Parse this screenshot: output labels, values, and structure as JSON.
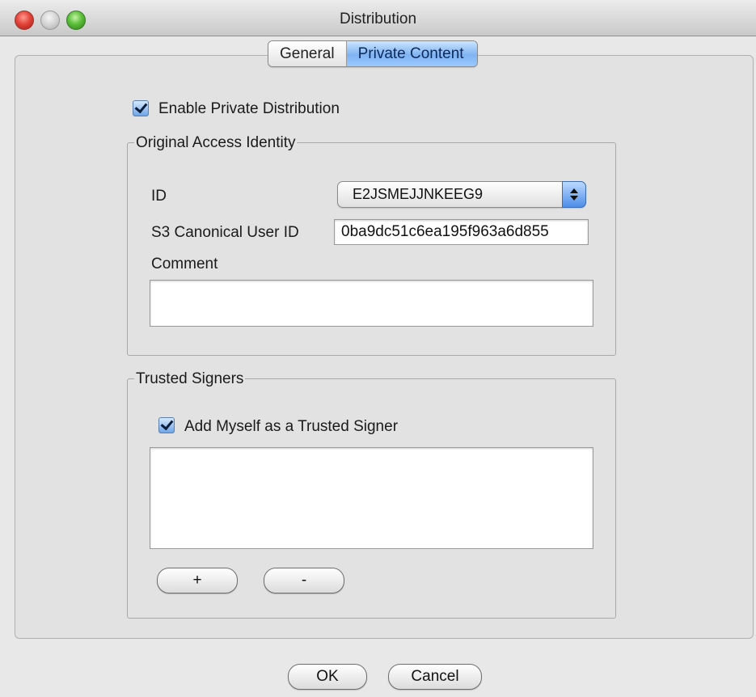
{
  "window": {
    "title": "Distribution"
  },
  "tabs": [
    {
      "label": "General",
      "selected": false
    },
    {
      "label": "Private Content",
      "selected": true
    }
  ],
  "enable_private": {
    "label": "Enable Private Distribution",
    "checked": true
  },
  "access_identity": {
    "legend": "Original Access Identity",
    "id_label": "ID",
    "id_value": "E2JSMEJJNKEEG9",
    "canonical_label": "S3 Canonical User ID",
    "canonical_value": "0ba9dc51c6ea195f963a6d855",
    "comment_label": "Comment",
    "comment_value": ""
  },
  "trusted_signers": {
    "legend": "Trusted Signers",
    "add_myself_label": "Add Myself as a Trusted Signer",
    "add_myself_checked": true,
    "add_button": "+",
    "remove_button": "-"
  },
  "footer": {
    "ok_label": "OK",
    "cancel_label": "Cancel"
  },
  "colors": {
    "accent": "#7fb3f2",
    "close": "#e2443a",
    "maximize": "#5bbf3a"
  }
}
